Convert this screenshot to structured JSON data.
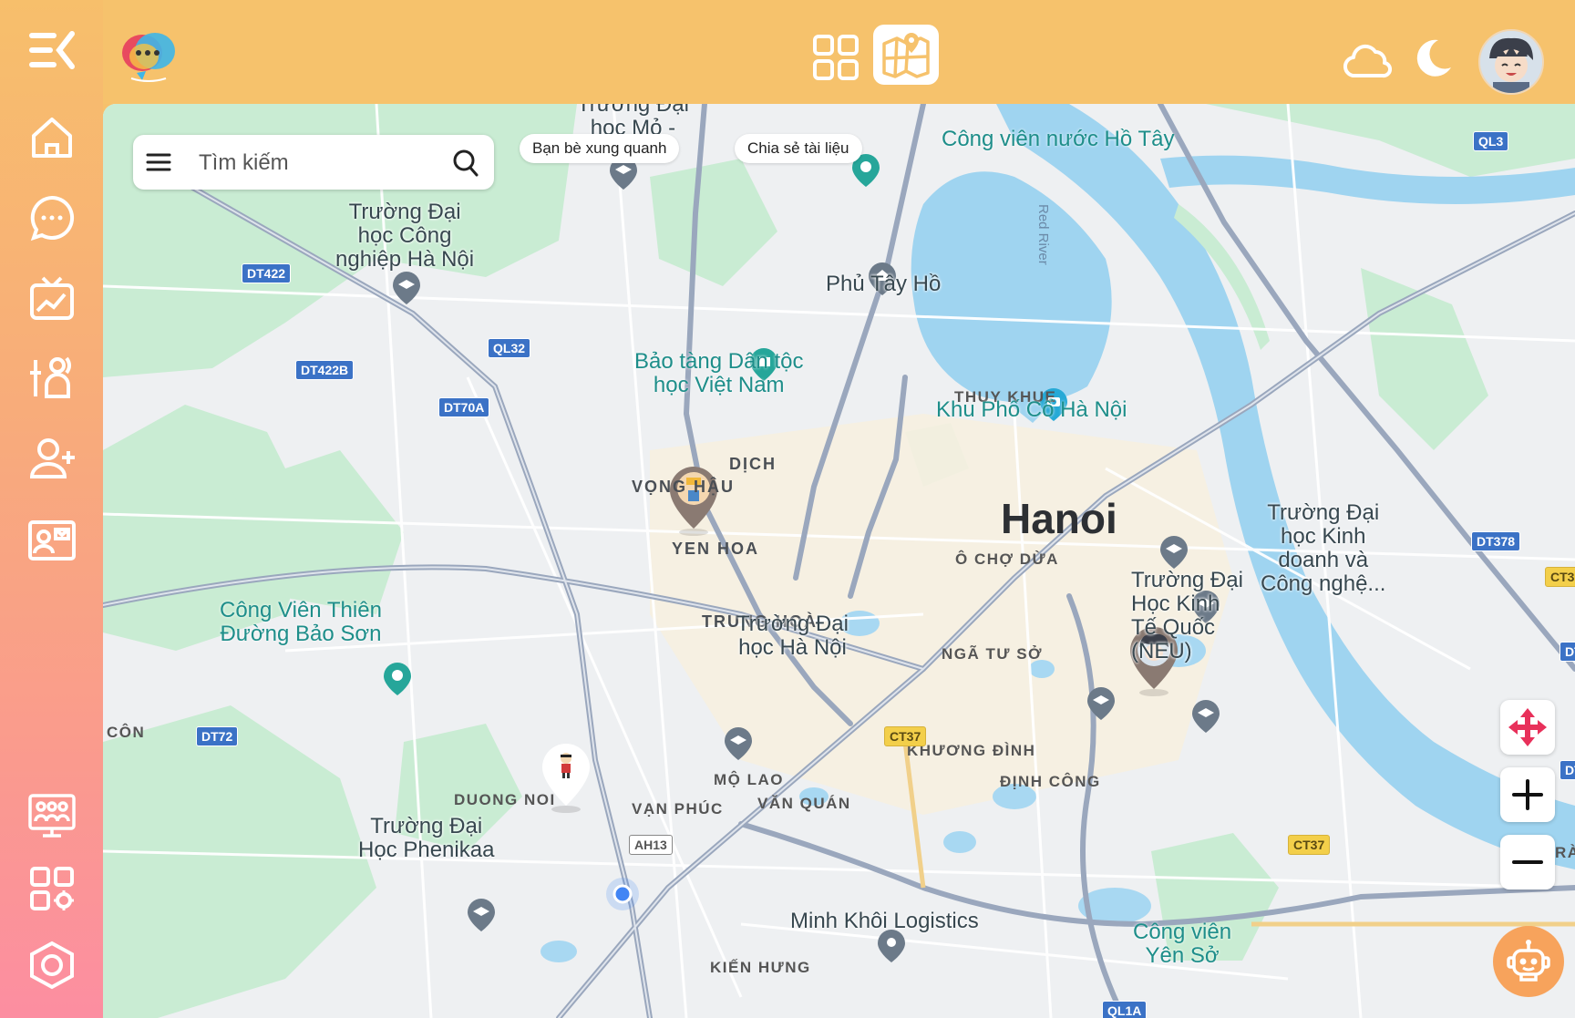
{
  "colors": {
    "accent": "#f6c26c",
    "sidebar_bottom": "#fc8ea1",
    "map_water": "#9fd4f0",
    "map_park": "#c5ebd0"
  },
  "sidebar": {
    "items": [
      {
        "icon": "collapse-menu-icon"
      },
      {
        "icon": "home-icon"
      },
      {
        "icon": "chat-icon"
      },
      {
        "icon": "dashboard-icon"
      },
      {
        "icon": "activity-icon"
      },
      {
        "icon": "add-friend-icon"
      },
      {
        "icon": "profile-card-icon"
      },
      {
        "icon": "classroom-icon"
      },
      {
        "icon": "apps-settings-icon"
      },
      {
        "icon": "settings-hexagon-icon"
      }
    ]
  },
  "header": {
    "view_icons": [
      "grid-view-icon",
      "map-view-icon"
    ],
    "right_icons": [
      "cloud-icon",
      "moon-icon",
      "avatar"
    ]
  },
  "search": {
    "placeholder": "Tìm kiếm"
  },
  "chips": {
    "friends_nearby": "Bạn bè xung quanh",
    "share_docs": "Chia sẻ tài liệu"
  },
  "map": {
    "city": "Hanoi",
    "districts": [
      "DỊCH",
      "VỌNG HẬU",
      "YEN HOA",
      "TRUNG HOÀ",
      "THUY KHUE",
      "Ô CHỢ DỪA",
      "NGÃ TƯ SỞ",
      "KHƯƠNG ĐÌNH",
      "ĐỊNH CÔNG",
      "MỘ LAO",
      "VĂN QUÁN",
      "VẠN PHÚC",
      "DUONG NOI",
      "CÔN",
      "KIẾN HƯNG",
      "RÀ"
    ],
    "places": {
      "p1": "Trường Đại\nhọc Mỏ -\nĐịa chất",
      "p2": "Trường Đại\nhọc Công\nnghiệp Hà Nội",
      "p3": "Công viên nước Hồ Tây",
      "p4": "Phủ Tây Hồ",
      "p5": "Bảo tàng Dân tộc\nhọc Việt Nam",
      "p6": "Khu Phố Cổ Hà Nội",
      "p7": "Trường Đại\nhọc Kinh\ndoanh và\nCông nghệ...",
      "p8": "Trường Đại\nHọc Kinh\nTế Quốc\n(NEU)",
      "p9": "Công Viên Thiên\nĐường Bảo Sơn",
      "p10": "Trường Đại\nhọc Hà Nội",
      "p11": "Trường Đại\nHọc Phenikaa",
      "p12": "Minh Khôi Logistics",
      "p13": "Công viên\nYên Sở",
      "p14": "Red River"
    },
    "roads": [
      "DT422",
      "QL32",
      "DT422B",
      "DT70A",
      "DT72",
      "QL3",
      "DT378",
      "CT37",
      "AH13",
      "CT3",
      "CT37",
      "QL1A",
      "DT",
      "DT"
    ]
  },
  "controls": {
    "move": "move-arrows-icon",
    "zoom_in": "plus-icon",
    "zoom_out": "minus-icon",
    "assistant": "robot-icon"
  }
}
